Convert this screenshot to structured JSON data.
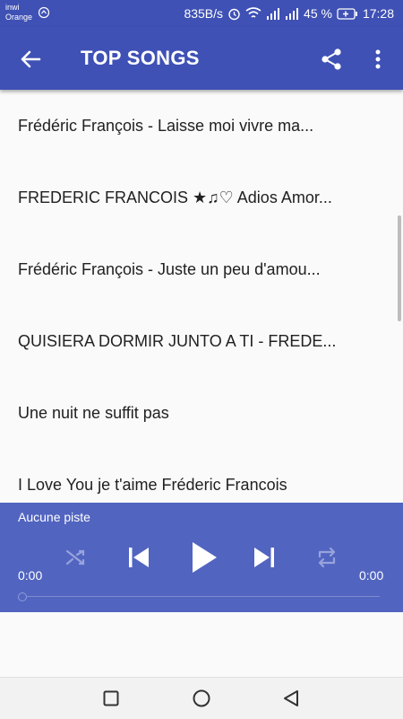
{
  "status_bar": {
    "carrier_line1": "inwi",
    "carrier_line2": "Orange",
    "speed": "835B/s",
    "battery_percent": "45 %",
    "time": "17:28"
  },
  "app_bar": {
    "title": "TOP SONGS",
    "color": "#3f51b5"
  },
  "songs": [
    "Frédéric François - Laisse moi vivre ma...",
    "FREDERIC FRANCOIS  ★♫♡ Adios Amor...",
    "Frédéric François - Juste un peu d'amou...",
    "QUISIERA DORMIR JUNTO A TI - FREDE...",
    "Une nuit ne suffit pas",
    "I Love You je t'aime  Fréderic Francois"
  ],
  "player": {
    "track": "Aucune piste",
    "elapsed": "0:00",
    "duration": "0:00",
    "progress": 0,
    "color": "#5164c0"
  },
  "icons": {
    "back": "arrow-left-icon",
    "share": "share-icon",
    "more": "more-vert-icon",
    "shuffle": "shuffle-icon",
    "previous": "skip-previous-icon",
    "play": "play-icon",
    "next": "skip-next-icon",
    "repeat": "repeat-icon"
  }
}
